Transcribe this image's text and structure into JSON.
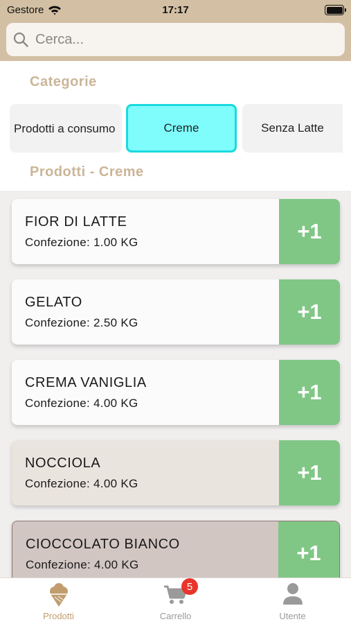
{
  "status_bar": {
    "carrier": "Gestore",
    "time": "17:17"
  },
  "search": {
    "placeholder": "Cerca..."
  },
  "categories": {
    "title": "Categorie",
    "items": [
      {
        "label": "Prodotti a consumo",
        "selected": false
      },
      {
        "label": "Creme",
        "selected": true
      },
      {
        "label": "Senza Latte",
        "selected": false
      }
    ]
  },
  "products": {
    "title": "Prodotti - Creme",
    "items": [
      {
        "name": "FIOR DI LATTE",
        "package": "Confezione: 1.00 KG",
        "action": "+1",
        "bg": "#fbfbfb"
      },
      {
        "name": "GELATO",
        "package": "Confezione: 2.50 KG",
        "action": "+1",
        "bg": "#fbfbfb"
      },
      {
        "name": "CREMA VANIGLIA",
        "package": "Confezione: 4.00 KG",
        "action": "+1",
        "bg": "#fbfbfb"
      },
      {
        "name": "NOCCIOLA",
        "package": "Confezione: 4.00 KG",
        "action": "+1",
        "bg": "#eae4de"
      },
      {
        "name": "CIOCCOLATO BIANCO",
        "package": "Confezione: 4.00 KG",
        "action": "+1",
        "bg": "#d2c6c3"
      }
    ]
  },
  "tabbar": {
    "items": [
      {
        "label": "Prodotti",
        "icon": "ice-cream-icon",
        "active": true
      },
      {
        "label": "Carrello",
        "icon": "cart-icon",
        "badge": "5",
        "active": false
      },
      {
        "label": "Utente",
        "icon": "user-icon",
        "active": false
      }
    ]
  },
  "colors": {
    "header": "#d3c0a4",
    "accent": "#cbb597",
    "selected_chip": "#7ffcfc",
    "add_button": "#80c785",
    "active_tab": "#c19d6e",
    "badge": "#e9342b"
  }
}
